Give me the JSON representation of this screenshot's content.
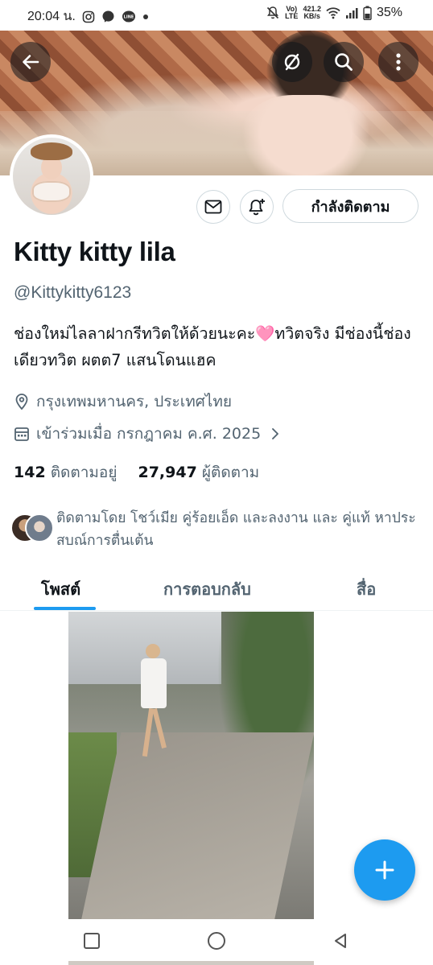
{
  "status_bar": {
    "time": "20:04 น.",
    "volte_line1": "Vo)",
    "volte_line2": "LTE",
    "net_speed_value": "421.2",
    "net_speed_unit": "KB/s",
    "battery": "35%",
    "icons": [
      "instagram-icon",
      "messenger-icon",
      "line-icon",
      "dot-icon",
      "mute-icon",
      "wifi-icon",
      "signal-icon",
      "battery-icon"
    ]
  },
  "header": {
    "icons": [
      "back-arrow-icon",
      "hide-eye-icon",
      "search-icon",
      "more-vertical-icon"
    ]
  },
  "profile": {
    "display_name": "Kitty kitty lila",
    "handle": "@Kittykitty6123",
    "bio": "ช่องใหม่ไลลาฝากรีทวิตให้ด้วยนะคะ🩷ทวิตจริง มีช่องนี้ช่องเดียวทวิต ผตต7 แสนโดนแฮค",
    "location": "กรุงเทพมหานคร, ประเทศไทย",
    "joined": "เข้าร่วมเมื่อ กรกฎาคม ค.ศ. 2025",
    "following_count": "142",
    "following_label": "ติดตามอยู่",
    "followers_count": "27,947",
    "followers_label": "ผู้ติดตาม",
    "followed_by": "ติดตามโดย โชว์เมีย คู่ร้อยเอ็ด และลงงาน และ คู่แท้ หาประสบณ์การตื่นเต้น",
    "follow_button_label": "กำลังติดตาม"
  },
  "tabs": [
    {
      "label": "โพสต์",
      "active": true
    },
    {
      "label": "การตอบกลับ",
      "active": false
    },
    {
      "label": "สื่อ",
      "active": false
    }
  ],
  "colors": {
    "accent": "#1d9bf0",
    "text_primary": "#0f1419",
    "text_secondary": "#536471",
    "border": "#cfd9de"
  },
  "fab": {
    "icon": "plus-icon"
  },
  "nav_bar": {
    "icons": [
      "recents-square-icon",
      "home-circle-icon",
      "back-triangle-icon"
    ]
  }
}
